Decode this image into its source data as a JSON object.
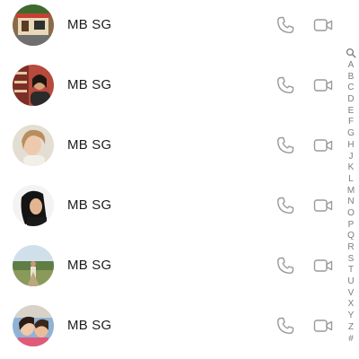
{
  "contacts": [
    {
      "name": "MB SG",
      "avatar": "photo-kiosk-street"
    },
    {
      "name": "MB SG",
      "avatar": "photo-woman-red-shelves"
    },
    {
      "name": "MB SG",
      "avatar": "photo-woman-light-hair"
    },
    {
      "name": "MB SG",
      "avatar": "photo-woman-dark-hair"
    },
    {
      "name": "MB SG",
      "avatar": "photo-outdoor-field"
    },
    {
      "name": "MB SG",
      "avatar": "photo-two-people-selfie"
    }
  ],
  "row_icons": {
    "call": "phone-icon",
    "video": "video-camera-icon"
  },
  "index_bar": {
    "search_icon": "search-icon",
    "letters": [
      "A",
      "B",
      "C",
      "D",
      "E",
      "F",
      "G",
      "H",
      "J",
      "K",
      "L",
      "M",
      "N",
      "O",
      "P",
      "Q",
      "R",
      "S",
      "T",
      "U",
      "V",
      "X",
      "Y",
      "Z",
      "#"
    ]
  },
  "colors": {
    "text": "#1c1c1c",
    "icon": "#9a9a9a",
    "index": "#7b7b7b",
    "background": "#ffffff"
  }
}
